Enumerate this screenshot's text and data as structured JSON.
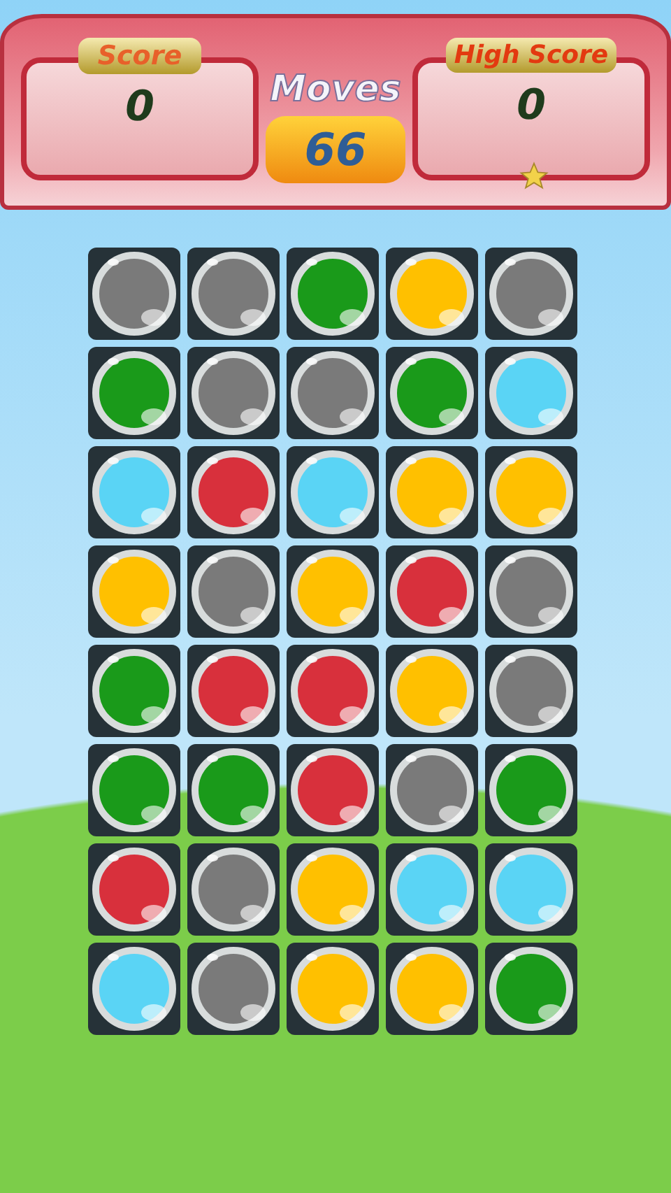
{
  "score": {
    "label": "Score",
    "value": "0"
  },
  "moves": {
    "label": "Moves",
    "value": "66"
  },
  "high_score": {
    "label": "High Score",
    "value": "0"
  },
  "grid": [
    [
      {
        "color": "#7a7a7a"
      },
      {
        "color": "#7a7a7a"
      },
      {
        "color": "#1a9a1a"
      },
      {
        "color": "#ffc000"
      },
      {
        "color": "#7a7a7a"
      }
    ],
    [
      {
        "color": "#1a9a1a"
      },
      {
        "color": "#7a7a7a"
      },
      {
        "color": "#7a7a7a"
      },
      {
        "color": "#1a9a1a"
      },
      {
        "color": "#5ad4f5"
      }
    ],
    [
      {
        "color": "#5ad4f5"
      },
      {
        "color": "#d8303c"
      },
      {
        "color": "#5ad4f5"
      },
      {
        "color": "#ffc000"
      },
      {
        "color": "#ffc000"
      }
    ],
    [
      {
        "color": "#ffc000"
      },
      {
        "color": "#7a7a7a"
      },
      {
        "color": "#ffc000"
      },
      {
        "color": "#d8303c"
      },
      {
        "color": "#7a7a7a"
      }
    ],
    [
      {
        "color": "#1a9a1a"
      },
      {
        "color": "#d8303c"
      },
      {
        "color": "#d8303c"
      },
      {
        "color": "#ffc000"
      },
      {
        "color": "#7a7a7a"
      }
    ],
    [
      {
        "color": "#1a9a1a"
      },
      {
        "color": "#1a9a1a"
      },
      {
        "color": "#d8303c"
      },
      {
        "color": "#7a7a7a"
      },
      {
        "color": "#1a9a1a"
      }
    ],
    [
      {
        "color": "#d8303c"
      },
      {
        "color": "#7a7a7a"
      },
      {
        "color": "#ffc000"
      },
      {
        "color": "#5ad4f5"
      },
      {
        "color": "#5ad4f5"
      }
    ],
    [
      {
        "color": "#5ad4f5"
      },
      {
        "color": "#7a7a7a"
      },
      {
        "color": "#ffc000"
      },
      {
        "color": "#ffc000"
      },
      {
        "color": "#1a9a1a"
      }
    ]
  ]
}
